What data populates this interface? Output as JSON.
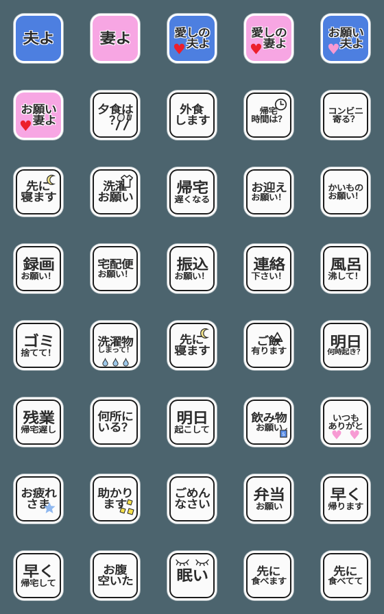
{
  "background_color": "#4c646e",
  "grid": {
    "columns": 5,
    "rows": 8,
    "total_stickers": 40
  },
  "palette": {
    "tile_white": "#fbfbfb",
    "tile_blue": "#4d7fe0",
    "tile_pink": "#f7a6e3",
    "text_dark": "#2b2b2b",
    "heart_red": "#ec1f2c",
    "heart_pink": "#f79ad3",
    "moon_yellow": "#f3e48b",
    "star_blue": "#8fb8ef",
    "droplet_blue": "#7fb2e5",
    "sparkle_yellow": "#f5e04a"
  },
  "stickers": [
    {
      "id": 1,
      "bg": "blue",
      "framed": false,
      "lines": [
        {
          "text": "夫よ",
          "size": "big"
        }
      ],
      "icons": []
    },
    {
      "id": 2,
      "bg": "pink",
      "framed": false,
      "lines": [
        {
          "text": "妻よ",
          "size": "big"
        }
      ],
      "icons": []
    },
    {
      "id": 3,
      "bg": "blue",
      "framed": false,
      "lines": [
        {
          "text": "愛しの",
          "size": "med"
        },
        {
          "text": "　夫よ",
          "size": "med"
        }
      ],
      "icons": [
        "heart-red-icon"
      ]
    },
    {
      "id": 4,
      "bg": "pink",
      "framed": false,
      "lines": [
        {
          "text": "愛しの",
          "size": "med"
        },
        {
          "text": "　妻よ",
          "size": "med"
        }
      ],
      "icons": [
        "heart-red-icon"
      ]
    },
    {
      "id": 5,
      "bg": "blue",
      "framed": false,
      "lines": [
        {
          "text": "お願い",
          "size": "med"
        },
        {
          "text": "　夫よ",
          "size": "med"
        }
      ],
      "icons": [
        "heart-pink-icon"
      ]
    },
    {
      "id": 6,
      "bg": "pink",
      "framed": false,
      "lines": [
        {
          "text": "お願い",
          "size": "med"
        },
        {
          "text": "　妻よ",
          "size": "med"
        }
      ],
      "icons": [
        "heart-red-icon"
      ]
    },
    {
      "id": 7,
      "bg": "white",
      "framed": true,
      "lines": [
        {
          "text": "夕食は",
          "size": "med"
        },
        {
          "text": "？",
          "size": "med"
        }
      ],
      "icons": [
        "utensils-icon"
      ]
    },
    {
      "id": 8,
      "bg": "white",
      "framed": true,
      "lines": [
        {
          "text": "外食",
          "size": "med"
        },
        {
          "text": "します",
          "size": "med"
        }
      ],
      "icons": []
    },
    {
      "id": 9,
      "bg": "white",
      "framed": true,
      "lines": [
        {
          "text": "帰宅",
          "size": "small"
        },
        {
          "text": "時間は？",
          "size": "small"
        }
      ],
      "icons": [
        "clock-icon"
      ]
    },
    {
      "id": 10,
      "bg": "white",
      "framed": true,
      "lines": [
        {
          "text": "コンビニ",
          "size": "small"
        },
        {
          "text": "寄る？",
          "size": "small"
        }
      ],
      "icons": []
    },
    {
      "id": 11,
      "bg": "white",
      "framed": true,
      "lines": [
        {
          "text": "先に",
          "size": "med"
        },
        {
          "text": "寝ます",
          "size": "med"
        }
      ],
      "icons": [
        "moon-icon"
      ]
    },
    {
      "id": 12,
      "bg": "white",
      "framed": true,
      "lines": [
        {
          "text": "洗濯",
          "size": "med"
        },
        {
          "text": "お願い",
          "size": "med"
        }
      ],
      "icons": [
        "shirt-icon"
      ]
    },
    {
      "id": 13,
      "bg": "white",
      "framed": true,
      "lines": [
        {
          "text": "帰宅",
          "size": "big"
        },
        {
          "text": "遅くなる",
          "size": "small"
        }
      ],
      "icons": []
    },
    {
      "id": 14,
      "bg": "white",
      "framed": true,
      "lines": [
        {
          "text": "お迎え",
          "size": "med"
        },
        {
          "text": "お願い！",
          "size": "small"
        }
      ],
      "icons": []
    },
    {
      "id": 15,
      "bg": "white",
      "framed": true,
      "lines": [
        {
          "text": "かいもの",
          "size": "small"
        },
        {
          "text": "お願い！",
          "size": "small"
        }
      ],
      "icons": []
    },
    {
      "id": 16,
      "bg": "white",
      "framed": true,
      "lines": [
        {
          "text": "録画",
          "size": "big"
        },
        {
          "text": "お願い！",
          "size": "small"
        }
      ],
      "icons": []
    },
    {
      "id": 17,
      "bg": "white",
      "framed": true,
      "lines": [
        {
          "text": "宅配便",
          "size": "med"
        },
        {
          "text": "お願い！",
          "size": "small"
        }
      ],
      "icons": []
    },
    {
      "id": 18,
      "bg": "white",
      "framed": true,
      "lines": [
        {
          "text": "振込",
          "size": "big"
        },
        {
          "text": "お願い！",
          "size": "small"
        }
      ],
      "icons": []
    },
    {
      "id": 19,
      "bg": "white",
      "framed": true,
      "lines": [
        {
          "text": "連絡",
          "size": "big"
        },
        {
          "text": "下さい！",
          "size": "small"
        }
      ],
      "icons": []
    },
    {
      "id": 20,
      "bg": "white",
      "framed": true,
      "lines": [
        {
          "text": "風呂",
          "size": "big"
        },
        {
          "text": "沸して！",
          "size": "small"
        }
      ],
      "icons": []
    },
    {
      "id": 21,
      "bg": "white",
      "framed": true,
      "lines": [
        {
          "text": "ゴミ",
          "size": "big"
        },
        {
          "text": "捨てて！",
          "size": "small"
        }
      ],
      "icons": []
    },
    {
      "id": 22,
      "bg": "white",
      "framed": true,
      "lines": [
        {
          "text": "洗濯物",
          "size": "med"
        },
        {
          "text": "しまって！",
          "size": "xsmall"
        }
      ],
      "icons": [
        "droplets-icon"
      ]
    },
    {
      "id": 23,
      "bg": "white",
      "framed": true,
      "lines": [
        {
          "text": "先に",
          "size": "med"
        },
        {
          "text": "寝ます",
          "size": "med"
        }
      ],
      "icons": [
        "moon-icon"
      ]
    },
    {
      "id": 24,
      "bg": "white",
      "framed": true,
      "lines": [
        {
          "text": "ご飯",
          "size": "med"
        },
        {
          "text": "有ります",
          "size": "small"
        }
      ],
      "icons": [
        "onigiri-icon"
      ]
    },
    {
      "id": 25,
      "bg": "white",
      "framed": true,
      "lines": [
        {
          "text": "明日",
          "size": "big"
        },
        {
          "text": "何時起き？",
          "size": "xsmall"
        }
      ],
      "icons": []
    },
    {
      "id": 26,
      "bg": "white",
      "framed": true,
      "lines": [
        {
          "text": "残業",
          "size": "big"
        },
        {
          "text": "帰宅遅し",
          "size": "small"
        }
      ],
      "icons": []
    },
    {
      "id": 27,
      "bg": "white",
      "framed": true,
      "lines": [
        {
          "text": "何所に",
          "size": "med"
        },
        {
          "text": "いる？",
          "size": "med"
        }
      ],
      "icons": []
    },
    {
      "id": 28,
      "bg": "white",
      "framed": true,
      "lines": [
        {
          "text": "明日",
          "size": "big"
        },
        {
          "text": "起こして",
          "size": "small"
        }
      ],
      "icons": []
    },
    {
      "id": 29,
      "bg": "white",
      "framed": true,
      "lines": [
        {
          "text": "飲み物",
          "size": "med"
        },
        {
          "text": "お願い",
          "size": "small"
        }
      ],
      "icons": [
        "juicebox-icon"
      ]
    },
    {
      "id": 30,
      "bg": "white",
      "framed": true,
      "lines": [
        {
          "text": "いつも",
          "size": "small"
        },
        {
          "text": "ありがと",
          "size": "small"
        }
      ],
      "icons": [
        "two-hearts-icon"
      ]
    },
    {
      "id": 31,
      "bg": "white",
      "framed": true,
      "lines": [
        {
          "text": "お疲れ",
          "size": "med"
        },
        {
          "text": "さま",
          "size": "med"
        }
      ],
      "icons": [
        "star-icon"
      ]
    },
    {
      "id": 32,
      "bg": "white",
      "framed": true,
      "lines": [
        {
          "text": "助かり",
          "size": "med"
        },
        {
          "text": "ます",
          "size": "med"
        }
      ],
      "icons": [
        "sparkles-icon"
      ]
    },
    {
      "id": 33,
      "bg": "white",
      "framed": true,
      "lines": [
        {
          "text": "ごめん",
          "size": "med"
        },
        {
          "text": "なさい",
          "size": "med"
        }
      ],
      "icons": []
    },
    {
      "id": 34,
      "bg": "white",
      "framed": true,
      "lines": [
        {
          "text": "弁当",
          "size": "big"
        },
        {
          "text": "お願い",
          "size": "small"
        }
      ],
      "icons": []
    },
    {
      "id": 35,
      "bg": "white",
      "framed": true,
      "lines": [
        {
          "text": "早く",
          "size": "big"
        },
        {
          "text": "帰ります",
          "size": "small"
        }
      ],
      "icons": []
    },
    {
      "id": 36,
      "bg": "white",
      "framed": true,
      "lines": [
        {
          "text": "早く",
          "size": "big"
        },
        {
          "text": "帰宅して",
          "size": "small"
        }
      ],
      "icons": []
    },
    {
      "id": 37,
      "bg": "white",
      "framed": true,
      "lines": [
        {
          "text": "お腹",
          "size": "med"
        },
        {
          "text": "空いた",
          "size": "med"
        }
      ],
      "icons": []
    },
    {
      "id": 38,
      "bg": "white",
      "framed": true,
      "lines": [
        {
          "text": "眠い",
          "size": "big"
        }
      ],
      "icons": [
        "eyelashes-icon"
      ]
    },
    {
      "id": 39,
      "bg": "white",
      "framed": true,
      "lines": [
        {
          "text": "先に",
          "size": "med"
        },
        {
          "text": "食べます",
          "size": "small"
        }
      ],
      "icons": []
    },
    {
      "id": 40,
      "bg": "white",
      "framed": true,
      "lines": [
        {
          "text": "先に",
          "size": "med"
        },
        {
          "text": "食べてて",
          "size": "small"
        }
      ],
      "icons": []
    }
  ]
}
